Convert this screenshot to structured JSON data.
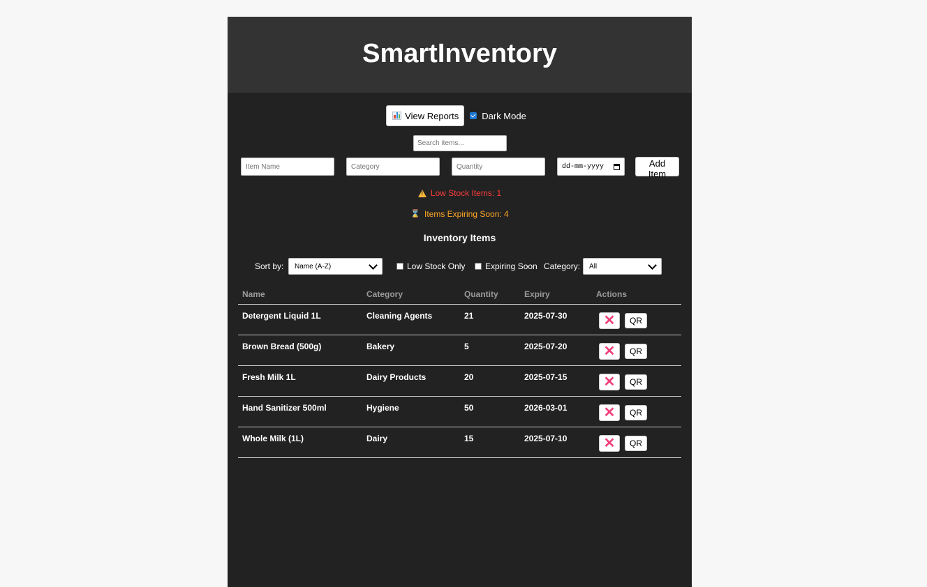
{
  "app": {
    "title": "SmartInventory"
  },
  "toolbar": {
    "reports_label": "View Reports",
    "reports_icon": "bar-chart-icon",
    "dark_mode_label": "Dark Mode",
    "dark_mode_checked": true
  },
  "search": {
    "placeholder": "Search items...",
    "value": ""
  },
  "add_form": {
    "name_placeholder": "Item Name",
    "category_placeholder": "Category",
    "quantity_placeholder": "Quantity",
    "date_placeholder": "dd-mm-yyyy",
    "date_icon": "calendar-icon",
    "add_label": "Add Item"
  },
  "alerts": {
    "low_stock": "Low Stock Items: 1",
    "low_stock_icon": "warning-icon",
    "expiring": "Items Expiring Soon: 4",
    "expiring_icon": "hourglass-icon"
  },
  "section": {
    "title": "Inventory Items"
  },
  "filters": {
    "sort_label": "Sort by:",
    "sort_value": "Name (A-Z)",
    "low_stock_label": "Low Stock Only",
    "low_stock_checked": false,
    "expiring_label": "Expiring Soon",
    "expiring_checked": false,
    "category_label": "Category:",
    "category_value": "All"
  },
  "table": {
    "headers": [
      "Name",
      "Category",
      "Quantity",
      "Expiry",
      "Actions"
    ],
    "rows": [
      {
        "name": "Detergent Liquid 1L",
        "category": "Cleaning Agents",
        "quantity": "21",
        "expiry": "2025-07-30"
      },
      {
        "name": "Brown Bread (500g)",
        "category": "Bakery",
        "quantity": "5",
        "expiry": "2025-07-20"
      },
      {
        "name": "Fresh Milk 1L",
        "category": "Dairy Products",
        "quantity": "20",
        "expiry": "2025-07-15"
      },
      {
        "name": "Hand Sanitizer 500ml",
        "category": "Hygiene",
        "quantity": "50",
        "expiry": "2026-03-01"
      },
      {
        "name": "Whole Milk (1L)",
        "category": "Dairy",
        "quantity": "15",
        "expiry": "2025-07-10"
      }
    ],
    "delete_symbol": "✕",
    "qr_label": "QR"
  },
  "colors": {
    "page_bg": "#f7f7f7",
    "app_bg": "#222222",
    "header_bg": "#333333",
    "low_stock": "#ff3b3b",
    "expiring": "#ffa726",
    "delete": "#f0417a",
    "checkbox": "#1f78d1"
  }
}
